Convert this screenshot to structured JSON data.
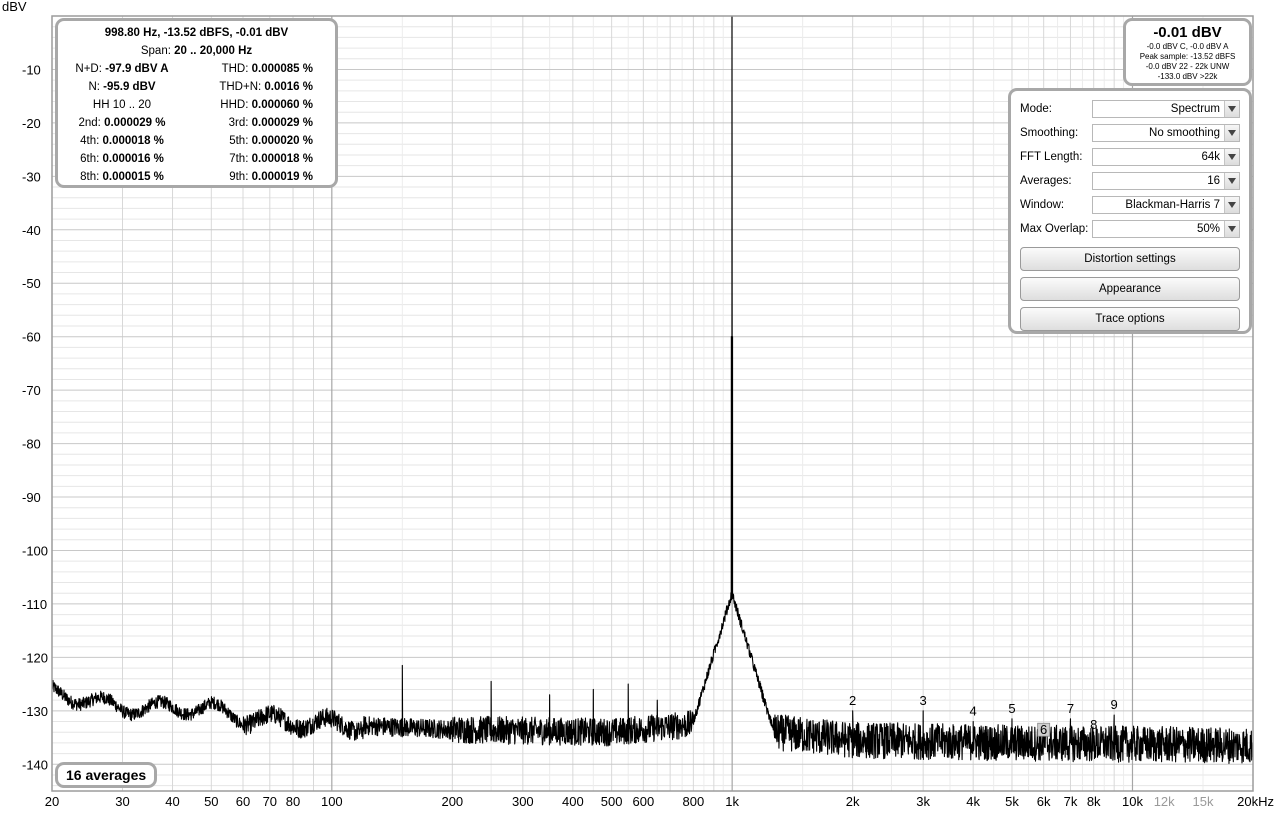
{
  "chart_data": {
    "type": "line",
    "ylabel": "dBV",
    "xscale": "log",
    "xlim": [
      20,
      20000
    ],
    "ylim": [
      -145,
      0
    ],
    "grid": true,
    "yticks": [
      "-10",
      "-20",
      "-30",
      "-40",
      "-50",
      "-60",
      "-70",
      "-80",
      "-90",
      "-100",
      "-110",
      "-120",
      "-130",
      "-140"
    ],
    "xticks": [
      {
        "v": 20,
        "label": "20"
      },
      {
        "v": 30,
        "label": "30"
      },
      {
        "v": 40,
        "label": "40"
      },
      {
        "v": 50,
        "label": "50"
      },
      {
        "v": 60,
        "label": "60"
      },
      {
        "v": 70,
        "label": "70"
      },
      {
        "v": 80,
        "label": "80"
      },
      {
        "v": 100,
        "label": "100"
      },
      {
        "v": 200,
        "label": "200"
      },
      {
        "v": 300,
        "label": "300"
      },
      {
        "v": 400,
        "label": "400"
      },
      {
        "v": 500,
        "label": "500"
      },
      {
        "v": 600,
        "label": "600"
      },
      {
        "v": 800,
        "label": "800"
      },
      {
        "v": 1000,
        "label": "1k"
      },
      {
        "v": 2000,
        "label": "2k"
      },
      {
        "v": 3000,
        "label": "3k"
      },
      {
        "v": 4000,
        "label": "4k"
      },
      {
        "v": 5000,
        "label": "5k"
      },
      {
        "v": 6000,
        "label": "6k"
      },
      {
        "v": 7000,
        "label": "7k"
      },
      {
        "v": 8000,
        "label": "8k"
      },
      {
        "v": 10000,
        "label": "10k"
      },
      {
        "v": 12000,
        "label": "12k",
        "grey": true
      },
      {
        "v": 15000,
        "label": "15k",
        "grey": true
      },
      {
        "v": 20000,
        "label": "20kHz"
      }
    ],
    "fundamental": {
      "freq": 998.8,
      "level": -0.01
    },
    "harmonic_markers": [
      {
        "label": "2",
        "freq": 2000,
        "level": -130
      },
      {
        "label": "3",
        "freq": 3000,
        "level": -130
      },
      {
        "label": "4",
        "freq": 4000,
        "level": -132
      },
      {
        "label": "5",
        "freq": 5000,
        "level": -131.5
      },
      {
        "label": "6",
        "freq": 6000,
        "level": -135.5
      },
      {
        "label": "7",
        "freq": 7000,
        "level": -131.5
      },
      {
        "label": "8",
        "freq": 8000,
        "level": -134.5
      },
      {
        "label": "9",
        "freq": 9000,
        "level": -130.8
      }
    ],
    "spurs": [
      {
        "freq": 150,
        "level": -121.5
      },
      {
        "freq": 250,
        "level": -124.5
      },
      {
        "freq": 350,
        "level": -127
      },
      {
        "freq": 450,
        "level": -126
      },
      {
        "freq": 550,
        "level": -125
      },
      {
        "freq": 650,
        "level": -128
      }
    ],
    "noise_floor": [
      {
        "f": 20,
        "db": -126.5
      },
      {
        "f": 30,
        "db": -129.5
      },
      {
        "f": 50,
        "db": -129.5
      },
      {
        "f": 60,
        "db": -131.5
      },
      {
        "f": 100,
        "db": -132.5
      },
      {
        "f": 200,
        "db": -133.5
      },
      {
        "f": 500,
        "db": -134
      },
      {
        "f": 800,
        "db": -132.5
      },
      {
        "f": 1500,
        "db": -134.5
      },
      {
        "f": 2000,
        "db": -135.5
      },
      {
        "f": 5000,
        "db": -136
      },
      {
        "f": 20000,
        "db": -136.5
      }
    ]
  },
  "stats": {
    "header": "998.80 Hz, -13.52 dBFS, -0.01 dBV",
    "span_label": "Span:",
    "span_value": "20 .. 20,000 Hz",
    "rows": [
      {
        "l": "N+D:",
        "lv": "-97.9 dBV A",
        "r": "THD:",
        "rv": "0.000085 %"
      },
      {
        "l": "N:",
        "lv": "-95.9 dBV",
        "r": "THD+N:",
        "rv": "0.0016 %"
      },
      {
        "l": "HH 10 .. 20",
        "lv": "",
        "r": "HHD:",
        "rv": "0.000060 %"
      },
      {
        "l": "2nd:",
        "lv": "0.000029 %",
        "r": "3rd:",
        "rv": "0.000029 %"
      },
      {
        "l": "4th:",
        "lv": "0.000018 %",
        "r": "5th:",
        "rv": "0.000020 %"
      },
      {
        "l": "6th:",
        "lv": "0.000016 %",
        "r": "7th:",
        "rv": "0.000018 %"
      },
      {
        "l": "8th:",
        "lv": "0.000015 %",
        "r": "9th:",
        "rv": "0.000019 %"
      }
    ]
  },
  "level": {
    "main": "-0.01 dBV",
    "lines": [
      "-0.0 dBV C, -0.0 dBV A",
      "Peak sample: -13.52 dBFS",
      "-0.0 dBV 22 - 22k UNW",
      "-133.0 dBV >22k"
    ]
  },
  "controls": {
    "mode": {
      "label": "Mode:",
      "value": "Spectrum"
    },
    "smoothing": {
      "label": "Smoothing:",
      "value": "No  smoothing"
    },
    "fft_length": {
      "label": "FFT Length:",
      "value": "64k"
    },
    "averages": {
      "label": "Averages:",
      "value": "16"
    },
    "window": {
      "label": "Window:",
      "value": "Blackman-Harris 7"
    },
    "max_overlap": {
      "label": "Max Overlap:",
      "value": "50%"
    },
    "distortion_button": "Distortion settings",
    "appearance_button": "Appearance",
    "trace_button": "Trace options"
  },
  "badge": {
    "averages": "16 averages"
  }
}
